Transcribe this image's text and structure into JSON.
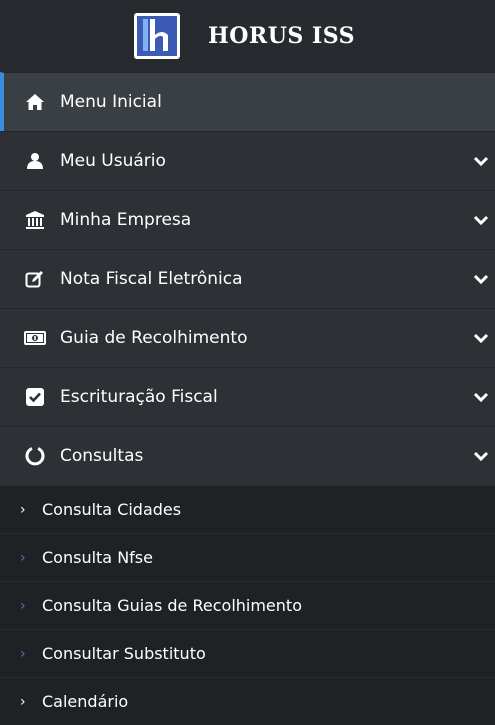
{
  "brand": {
    "title": "HORUS ISS",
    "logo_icon": "horus-logo"
  },
  "menu": [
    {
      "label": "Menu Inicial",
      "icon": "home-icon",
      "active": true,
      "expandable": false
    },
    {
      "label": "Meu Usuário",
      "icon": "user-icon",
      "expandable": true
    },
    {
      "label": "Minha Empresa",
      "icon": "bank-icon",
      "expandable": true
    },
    {
      "label": "Nota Fiscal Eletrônica",
      "icon": "edit-icon",
      "expandable": true
    },
    {
      "label": "Guia de Recolhimento",
      "icon": "money-icon",
      "expandable": true
    },
    {
      "label": "Escrituração Fiscal",
      "icon": "check-square-icon",
      "expandable": true
    },
    {
      "label": "Consultas",
      "icon": "spinner-icon",
      "expandable": true,
      "expanded": true
    }
  ],
  "submenu": [
    {
      "label": "Consulta Cidades"
    },
    {
      "label": "Consulta Nfse"
    },
    {
      "label": "Consulta Guias de Recolhimento"
    },
    {
      "label": "Consultar Substituto"
    },
    {
      "label": "Calendário"
    }
  ],
  "colors": {
    "accent": "#3a8dde",
    "sidebar_bg": "#2b2f33",
    "submenu_bg": "#1f2225"
  }
}
